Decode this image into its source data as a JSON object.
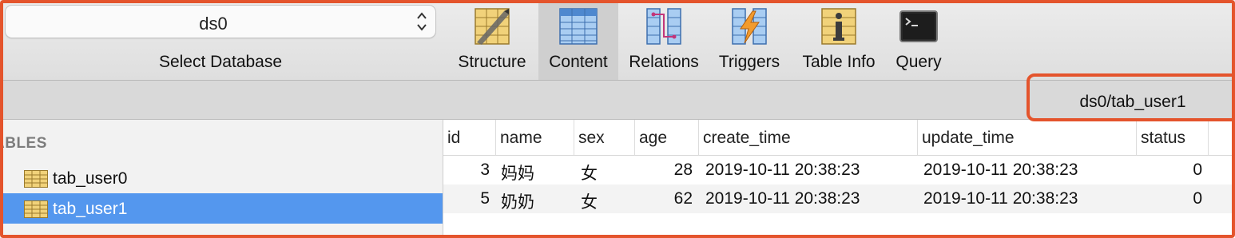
{
  "toolbar": {
    "database": {
      "selected": "ds0",
      "label": "Select Database"
    },
    "buttons": [
      {
        "label": "Structure",
        "icon": "structure-icon",
        "active": false
      },
      {
        "label": "Content",
        "icon": "content-icon",
        "active": true
      },
      {
        "label": "Relations",
        "icon": "relations-icon",
        "active": false
      },
      {
        "label": "Triggers",
        "icon": "triggers-icon",
        "active": false
      },
      {
        "label": "Table Info",
        "icon": "table-info-icon",
        "active": false
      },
      {
        "label": "Query",
        "icon": "query-icon",
        "active": false
      }
    ]
  },
  "path": "ds0/tab_user1",
  "sidebar": {
    "header": "ABLES",
    "tables": [
      {
        "name": "tab_user0",
        "selected": false
      },
      {
        "name": "tab_user1",
        "selected": true
      }
    ]
  },
  "grid": {
    "columns": [
      "id",
      "name",
      "sex",
      "age",
      "create_time",
      "update_time",
      "status"
    ],
    "rows": [
      {
        "id": "3",
        "name": "妈妈",
        "sex": "女",
        "age": "28",
        "create_time": "2019-10-11 20:38:23",
        "update_time": "2019-10-11 20:38:23",
        "status": "0"
      },
      {
        "id": "5",
        "name": "奶奶",
        "sex": "女",
        "age": "62",
        "create_time": "2019-10-11 20:38:23",
        "update_time": "2019-10-11 20:38:23",
        "status": "0"
      }
    ]
  },
  "colors": {
    "highlight": "#e4542c",
    "selection": "#5497ee"
  }
}
